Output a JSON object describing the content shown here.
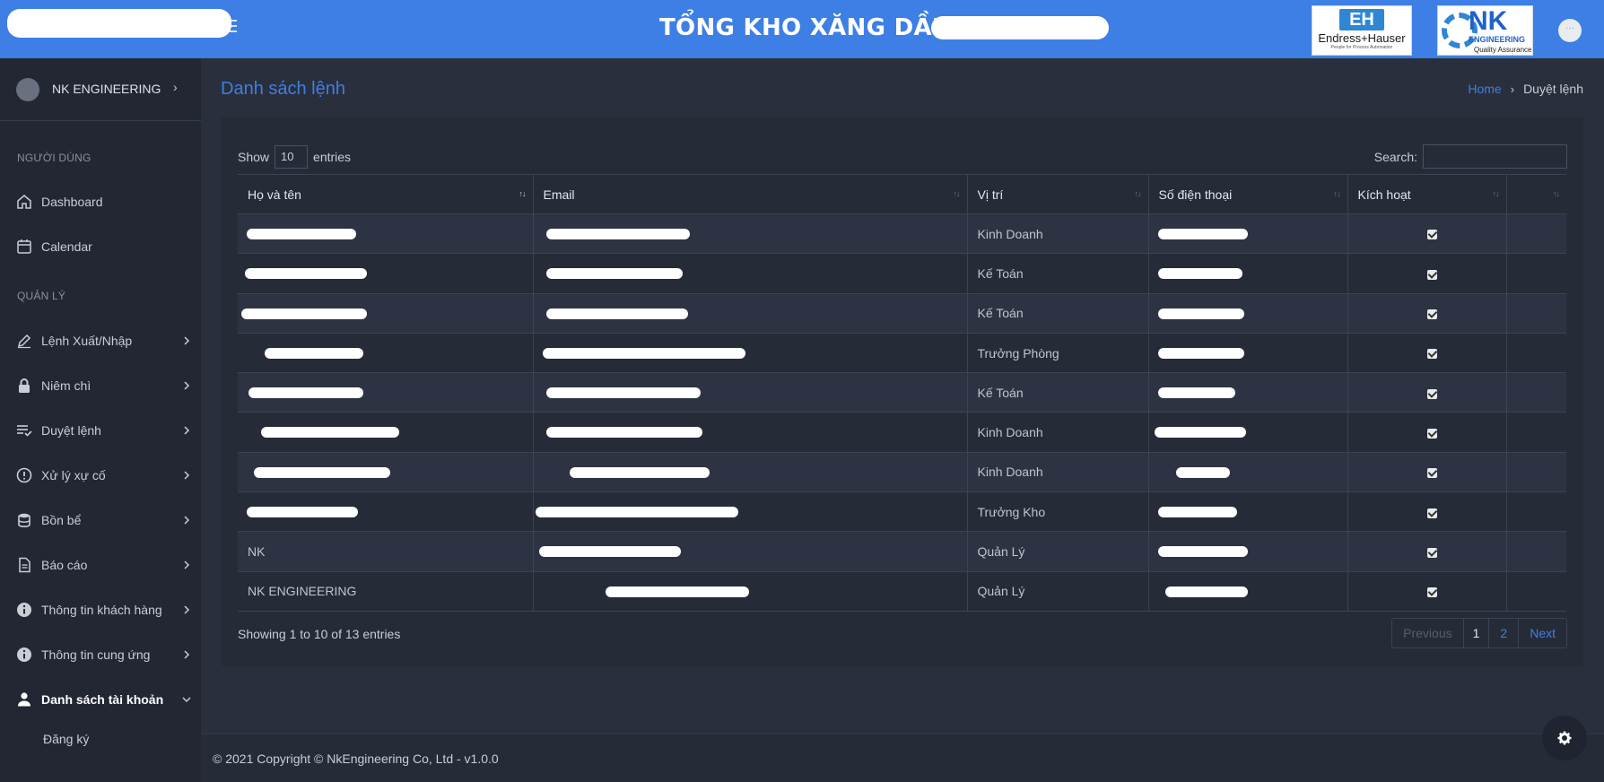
{
  "header": {
    "title": "TỔNG KHO XĂNG DẦU",
    "logo_eh": {
      "mark": "EH",
      "name": "Endress+Hauser",
      "tagline": "People for Process Automation"
    },
    "logo_nk": {
      "mark": "NK",
      "sub": "ENGINEERING",
      "tagline": "Quality Assurance"
    }
  },
  "sidebar": {
    "user_name": "NK ENGINEERING",
    "section_user": "NGƯỜI DÙNG",
    "section_manage": "QUẢN LÝ",
    "items": [
      {
        "label": "Dashboard",
        "icon": "home-icon"
      },
      {
        "label": "Calendar",
        "icon": "calendar-icon"
      },
      {
        "label": "Lệnh Xuất/Nhập",
        "icon": "pencil-icon"
      },
      {
        "label": "Niêm chì",
        "icon": "lock-icon"
      },
      {
        "label": "Duyệt lệnh",
        "icon": "checklist-icon"
      },
      {
        "label": "Xử lý xự cố",
        "icon": "alert-icon"
      },
      {
        "label": "Bồn bể",
        "icon": "database-icon"
      },
      {
        "label": "Báo cáo",
        "icon": "report-icon"
      },
      {
        "label": "Thông tin khách hàng",
        "icon": "info-icon"
      },
      {
        "label": "Thông tin cung ứng",
        "icon": "info-icon"
      },
      {
        "label": "Danh sách tài khoản",
        "icon": "user-icon"
      }
    ],
    "sub_item": "Đăng ký"
  },
  "page": {
    "title": "Danh sách lệnh",
    "breadcrumb_home": "Home",
    "breadcrumb_current": "Duyệt lệnh"
  },
  "table": {
    "show_label": "Show",
    "entries_label": "entries",
    "page_size": "10",
    "search_label": "Search:",
    "columns": [
      "Họ và tên",
      "Email",
      "Vị trí",
      "Số điện thoại",
      "Kích hoạt",
      ""
    ],
    "rows": [
      {
        "name": "",
        "email": "",
        "position": "Kinh Doanh",
        "phone": "",
        "active": true
      },
      {
        "name": "",
        "email": "",
        "position": "Kế Toán",
        "phone": "",
        "active": true
      },
      {
        "name": "",
        "email": "",
        "position": "Kế Toán",
        "phone": "",
        "active": true
      },
      {
        "name": "",
        "email": "",
        "position": "Trưởng Phòng",
        "phone": "",
        "active": true
      },
      {
        "name": "",
        "email": "",
        "position": "Kế Toán",
        "phone": "",
        "active": true
      },
      {
        "name": "",
        "email": "",
        "position": "Kinh Doanh",
        "phone": "",
        "active": true
      },
      {
        "name": "",
        "email": "",
        "position": "Kinh Doanh",
        "phone": "",
        "active": true
      },
      {
        "name": "",
        "email": "",
        "position": "Trưởng Kho",
        "phone": "",
        "active": true
      },
      {
        "name": "NK",
        "email": "",
        "position": "Quản Lý",
        "phone": "",
        "active": true
      },
      {
        "name": "NK ENGINEERING",
        "email": "",
        "position": "Quản Lý",
        "phone": "",
        "active": true
      }
    ],
    "info": "Showing 1 to 10 of 13 entries",
    "pagination": {
      "previous": "Previous",
      "pages": [
        "1",
        "2"
      ],
      "next": "Next"
    }
  },
  "footer": {
    "text": "© 2021 Copyright © NkEngineering Co, Ltd - v1.0.0"
  }
}
